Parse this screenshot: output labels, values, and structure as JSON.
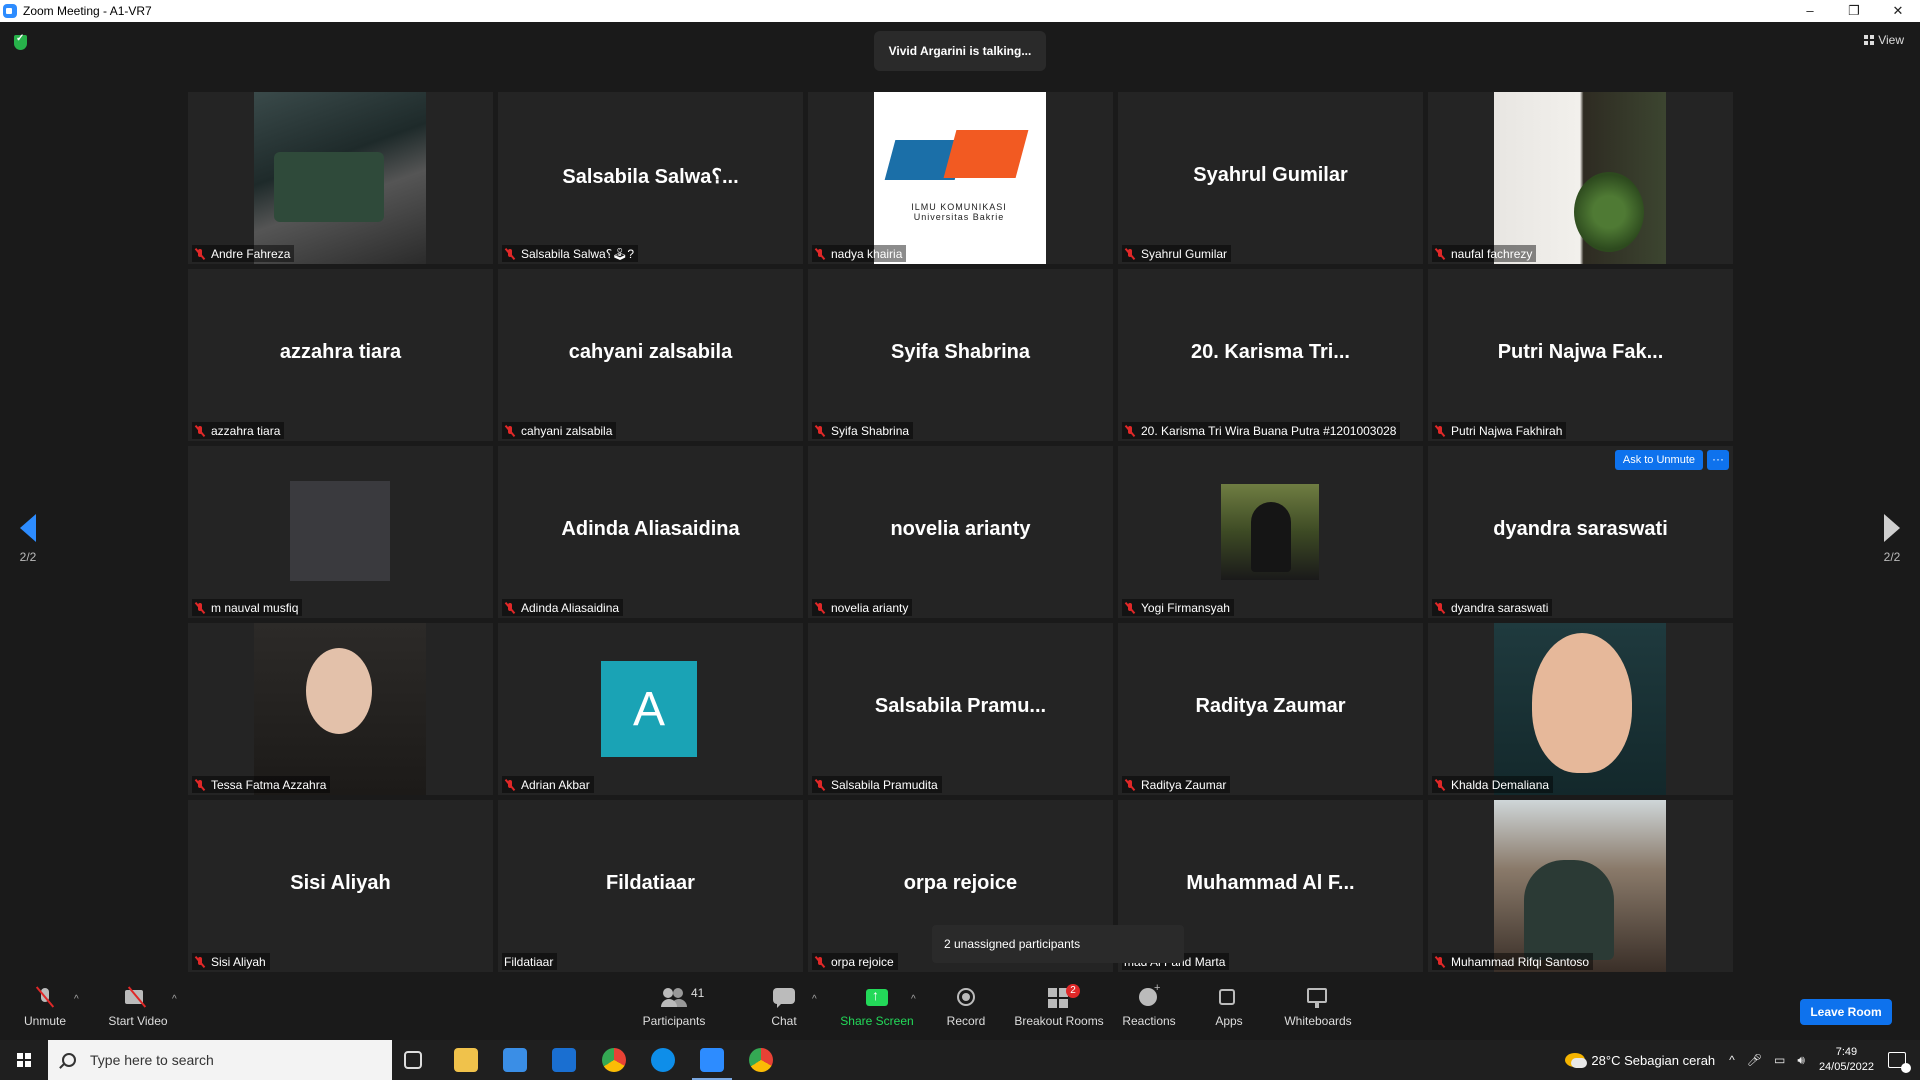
{
  "window": {
    "title": "Zoom Meeting - A1-VR7",
    "controls": [
      "–",
      "❐",
      "✕"
    ]
  },
  "meeting": {
    "talking": "Vivid Argarini is talking...",
    "view_label": "View",
    "page_left": "2/2",
    "page_right": "2/2",
    "unassigned": "2 unassigned participants",
    "ask_to_unmute": "Ask to Unmute",
    "more_label": "···"
  },
  "tiles": [
    {
      "display": "",
      "label": "Andre Fahreza",
      "muted": true,
      "video": "andre"
    },
    {
      "display": "Salsabila  Salwa؟...",
      "label": "Salsabila Salwa؟🕹?",
      "muted": true
    },
    {
      "display": "",
      "label": "nadya khairia",
      "muted": true,
      "video": "nadya",
      "logo_text": "ILMU KOMUNIKASI Universitas Bakrie"
    },
    {
      "display": "Syahrul Gumilar",
      "label": "Syahrul Gumilar",
      "muted": true
    },
    {
      "display": "",
      "label": "naufal fachrezy",
      "muted": true,
      "video": "naufal"
    },
    {
      "display": "azzahra tiara",
      "label": "azzahra tiara",
      "muted": true
    },
    {
      "display": "cahyani zalsabila",
      "label": "cahyani zalsabila",
      "muted": true
    },
    {
      "display": "Syifa Shabrina",
      "label": "Syifa Shabrina",
      "muted": true
    },
    {
      "display": "20. Karisma Tri...",
      "label": "20. Karisma Tri Wira Buana Putra #1201003028",
      "muted": true
    },
    {
      "display": "Putri Najwa Fak...",
      "label": "Putri Najwa Fakhirah",
      "muted": true
    },
    {
      "display": "",
      "label": "m nauval musfiq",
      "muted": true,
      "video": "nauval"
    },
    {
      "display": "Adinda Aliasaidina",
      "label": "Adinda Aliasaidina",
      "muted": true
    },
    {
      "display": "novelia arianty",
      "label": "novelia arianty",
      "muted": true
    },
    {
      "display": "",
      "label": "Yogi Firmansyah",
      "muted": true,
      "video": "yogi"
    },
    {
      "display": "dyandra saraswati",
      "label": "dyandra saraswati",
      "muted": true,
      "ask": true
    },
    {
      "display": "",
      "label": "Tessa Fatma Azzahra",
      "muted": true,
      "video": "tessa"
    },
    {
      "display": "",
      "label": "Adrian Akbar",
      "muted": true,
      "avatar": "A"
    },
    {
      "display": "Salsabila  Pramu...",
      "label": "Salsabila Pramudita",
      "muted": true
    },
    {
      "display": "Raditya Zaumar",
      "label": "Raditya Zaumar",
      "muted": true
    },
    {
      "display": "",
      "label": "Khalda Demaliana",
      "muted": true,
      "video": "khalda"
    },
    {
      "display": "Sisi Aliyah",
      "label": "Sisi Aliyah",
      "muted": true
    },
    {
      "display": "Fildatiaar",
      "label": "Fildatiaar",
      "muted": false
    },
    {
      "display": "orpa rejoice",
      "label": "orpa rejoice",
      "muted": true
    },
    {
      "display": "Muhammad  Al F...",
      "label": "mad Al Farid Marta",
      "muted": false
    },
    {
      "display": "",
      "label": "Muhammad Rifqi Santoso",
      "muted": true,
      "video": "rifqi"
    }
  ],
  "toolbar": {
    "unmute": "Unmute",
    "start_video": "Start Video",
    "participants": "Participants",
    "participants_count": "41",
    "chat": "Chat",
    "share_screen": "Share Screen",
    "record": "Record",
    "breakout_rooms": "Breakout Rooms",
    "breakout_badge": "2",
    "reactions": "Reactions",
    "apps": "Apps",
    "whiteboards": "Whiteboards",
    "leave": "Leave Room",
    "caret": "^",
    "share_color": "#23d959",
    "leave_color": "#0e72ed"
  },
  "taskbar": {
    "search_placeholder": "Type here to search",
    "weather": "28°C  Sebagian cerah",
    "tray_caret": "^",
    "time": "7:49",
    "date": "24/05/2022",
    "apps": [
      "task-view-icon",
      "file-explorer-icon",
      "store-icon",
      "mail-icon",
      "chrome-icon",
      "teamviewer-icon",
      "zoom-icon",
      "chrome-alt-icon"
    ]
  }
}
